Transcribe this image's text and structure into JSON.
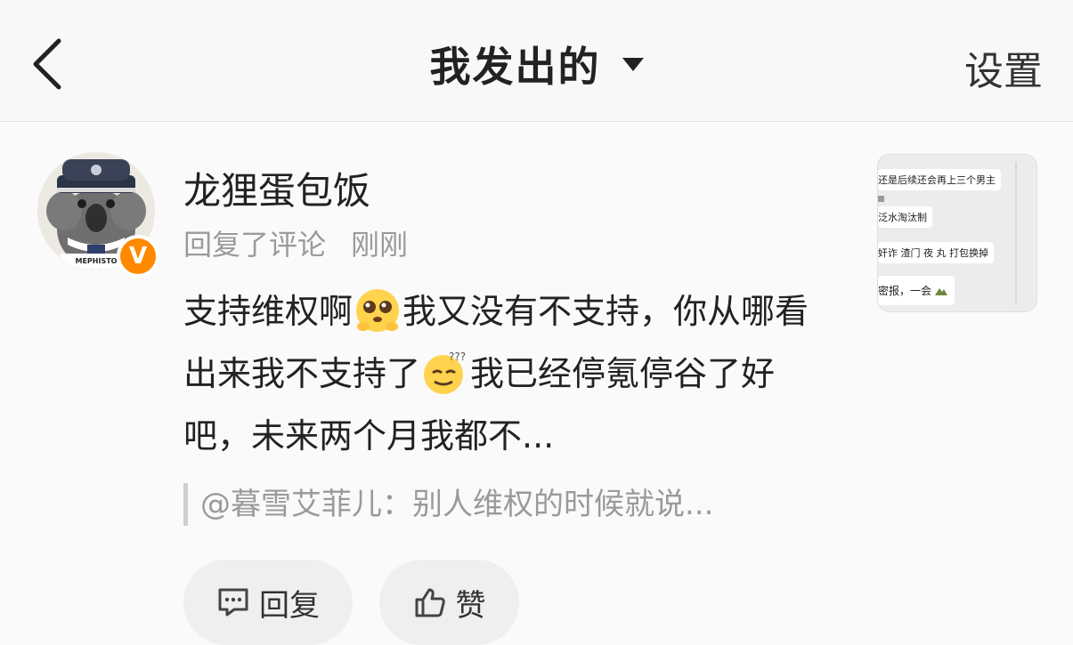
{
  "header": {
    "title": "我发出的",
    "settings_label": "设置"
  },
  "post": {
    "username": "龙狸蛋包饭",
    "action": "回复了评论",
    "time": "刚刚",
    "avatar_caption": "MEPHISTO",
    "verified_mark": "V",
    "content_1": "支持维权啊",
    "content_2": "我又没有不支持，你从哪看出来我不支持了",
    "content_3": "我已经停氪停谷了好吧，未来两个月我都不...",
    "quote": "@暮雪艾菲儿：别人维权的时候就说..."
  },
  "actions": {
    "reply_label": "回复",
    "like_label": "赞"
  },
  "thumbnail": {
    "line1": "还是后续还会再上三个男主",
    "line2": "泛水淘汰制",
    "line3": "奸诈 渣门 夜 丸 打包换掉",
    "line4": "密报，一会"
  },
  "colors": {
    "verified": "#ff8a00",
    "muted_text": "#9a9a9a"
  },
  "icons": [
    "back-icon",
    "dropdown-caret-icon",
    "verified-icon",
    "reply-icon",
    "like-icon"
  ]
}
